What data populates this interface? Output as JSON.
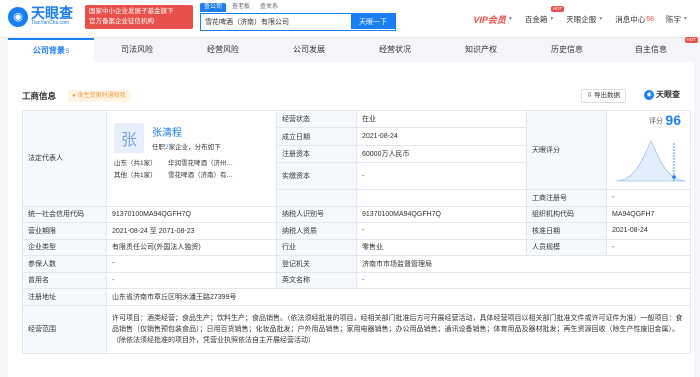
{
  "header": {
    "logo_text": "天眼查",
    "logo_sub": "TianYanCha.com",
    "promo_lines": [
      "国家中小企业发展子基金旗下",
      "官方备案企业征信机构"
    ],
    "search_tabs": [
      "查公司",
      "查老板",
      "查关系"
    ],
    "search_value": "雪花啤酒（济南）有限公司",
    "search_button": "天眼一下",
    "nav": {
      "vip": "VIP会员",
      "baijinbao": "百金箱",
      "tianyan_enterprise": "天眼企服",
      "messages": "消息中心",
      "messages_count": "68",
      "user": "陈宇"
    },
    "hot": "HOT"
  },
  "tabs": [
    {
      "label": "公司背景",
      "count": "5",
      "active": true
    },
    {
      "label": "司法风险"
    },
    {
      "label": "经营风险"
    },
    {
      "label": "公司发展"
    },
    {
      "label": "经营状况"
    },
    {
      "label": "知识产权"
    },
    {
      "label": "历史信息"
    },
    {
      "label": "自主信息",
      "hot": "HOT"
    }
  ],
  "section": {
    "title": "工商信息",
    "warning": "发生变更时通知我",
    "export": "导出数据",
    "brand": "天眼查"
  },
  "legal_rep": {
    "label": "法定代表人",
    "avatar_char": "张",
    "name": "张清程",
    "desc_prefix": "任职",
    "desc_count": "2",
    "desc_suffix": "家企业，分布如下",
    "dist": [
      {
        "region": "山东（共1家）",
        "company": "华润雪花啤酒（济州…"
      },
      {
        "region": "其他（共1家）",
        "company": "雪花啤酒（济南）有…"
      }
    ]
  },
  "fields": {
    "status_label": "经营状态",
    "status": "在业",
    "founded_label": "成立日期",
    "founded": "2021-08-24",
    "capital_label": "注册资本",
    "capital": "60000万人民币",
    "paid_label": "实缴资本",
    "paid": "-",
    "score_label": "天眼评分",
    "score_word": "评分",
    "score": "96",
    "biz_reg_label": "工商注册号",
    "biz_reg": "-",
    "credit_label": "统一社会信用代码",
    "credit": "91370100MA94QGFH7Q",
    "taxpayer_label": "纳税人识别号",
    "taxpayer": "91370100MA94QGFH7Q",
    "org_code_label": "组织机构代码",
    "org_code": "MA94QGFH7",
    "term_label": "营业期限",
    "term": "2021-08-24 至 2071-08-23",
    "qualification_label": "纳税人资质",
    "qualification": "-",
    "approval_label": "核准日期",
    "approval": "2021-08-24",
    "type_label": "企业类型",
    "type": "有限责任公司(外国法人独资)",
    "industry_label": "行业",
    "industry": "零售业",
    "scale_label": "人员规模",
    "scale": "-",
    "insured_label": "参保人数",
    "insured": "-",
    "authority_label": "登记机关",
    "authority": "济南市市场监督管理局",
    "former_label": "曾用名",
    "former": "-",
    "english_label": "英文名称",
    "english": "-",
    "address_label": "注册地址",
    "address": "山东省济南市章丘区明水潘王路27399号",
    "scope_label": "经营范围",
    "scope": "许可项目：酒类经营；食品生产；饮料生产；食品销售。（依法须经批准的项目，经相关部门批准后方可开展经营活动，具体经营项目以相关部门批准文件或许可证件为准）一般项目：食品销售（仅销售预包装食品）；日用百货销售；化妆品批发；户外用品销售；家用电器销售；办公用品销售；通讯设备销售；体育用品及器材批发；再生资源回收（除生产性废旧金属）。（除依法须经批准的项目外，凭营业执照依法自主开展经营活动）"
  }
}
